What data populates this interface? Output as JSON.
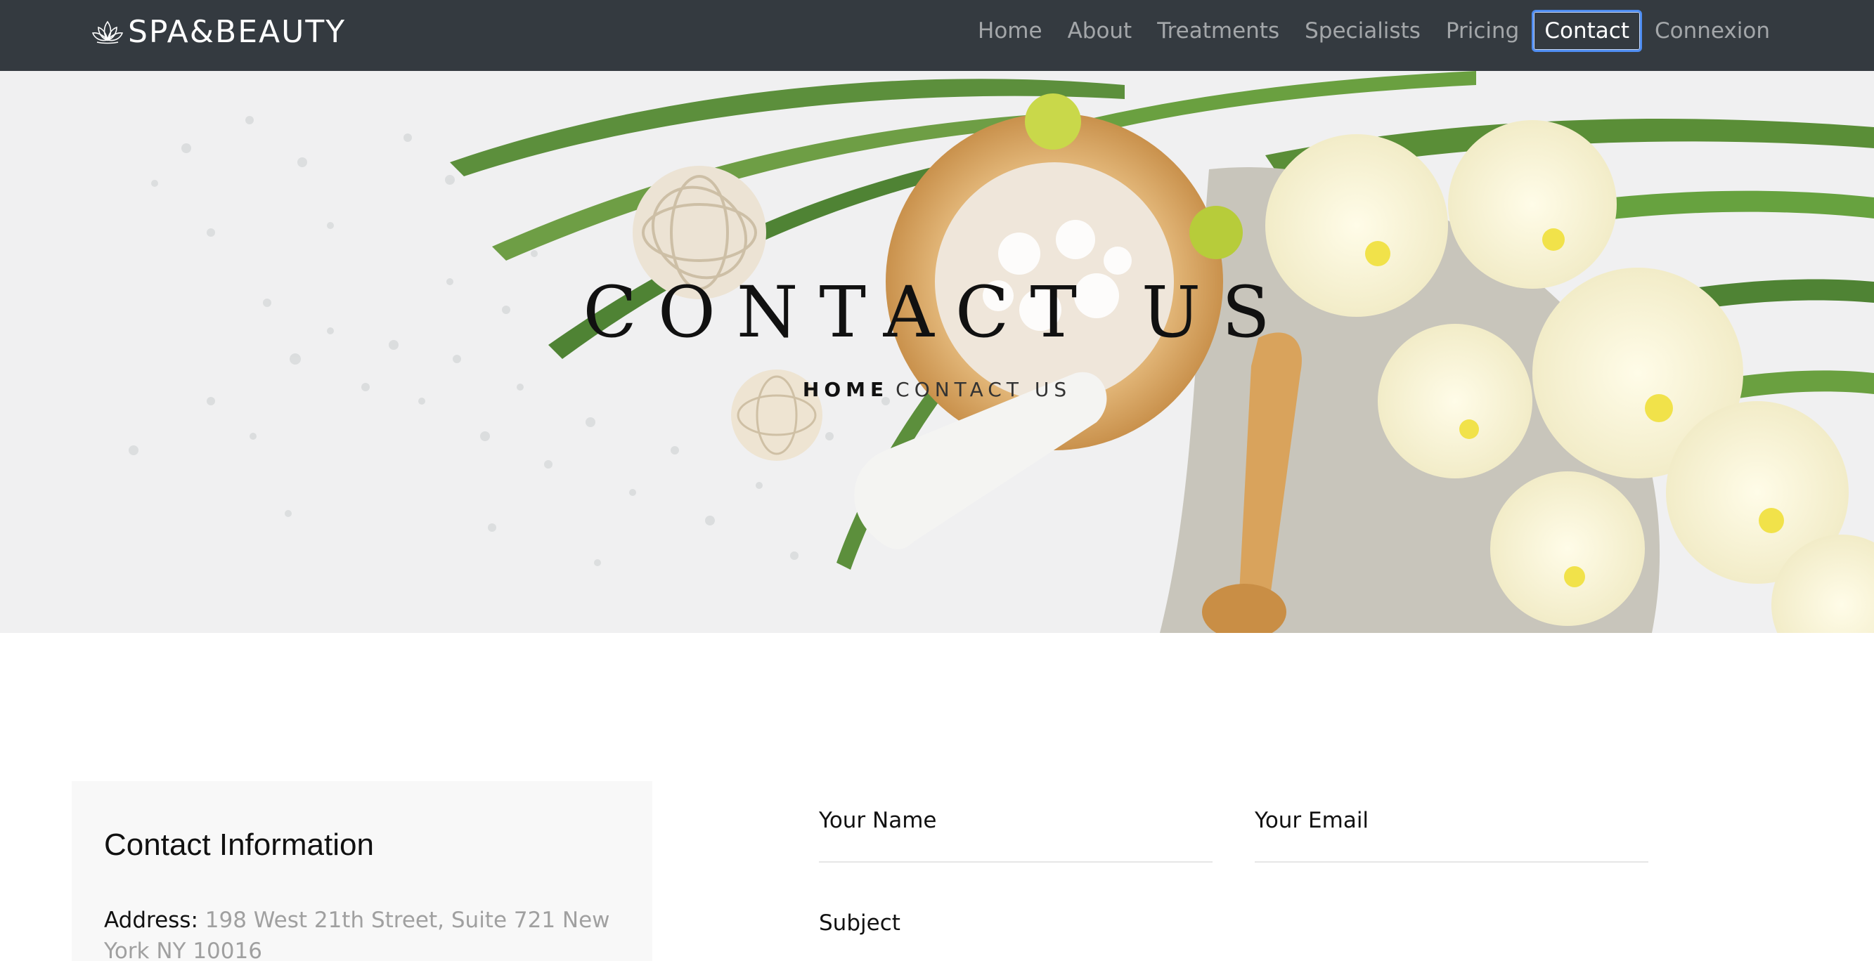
{
  "brand": {
    "name": "SPA&BEAUTY",
    "logo_icon": "lotus-icon"
  },
  "nav": {
    "items": [
      {
        "label": "Home",
        "active": false
      },
      {
        "label": "About",
        "active": false
      },
      {
        "label": "Treatments",
        "active": false
      },
      {
        "label": "Specialists",
        "active": false
      },
      {
        "label": "Pricing",
        "active": false
      },
      {
        "label": "Contact",
        "active": true
      },
      {
        "label": "Connexion",
        "active": false
      }
    ]
  },
  "hero": {
    "title": "CONTACT US",
    "breadcrumb": {
      "home": "HOME",
      "current": "CONTACT US"
    }
  },
  "contact_info": {
    "title": "Contact Information",
    "address_label": "Address:",
    "address_value": "198 West 21th Street, Suite 721 New York NY 10016"
  },
  "form": {
    "name_label": "Your Name",
    "email_label": "Your Email",
    "subject_label": "Subject"
  },
  "colors": {
    "navbar_bg": "#343a40",
    "active_outline": "#4e8cf0",
    "card_bg": "#f8f8f8"
  }
}
